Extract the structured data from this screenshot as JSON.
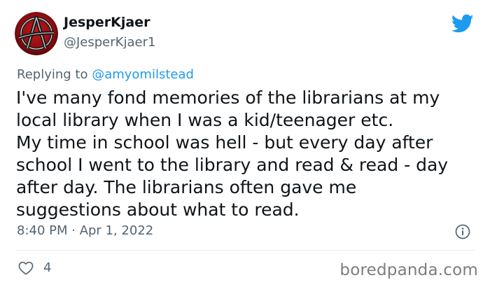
{
  "author": {
    "display_name": "JesperKjaer",
    "handle": "@JesperKjaer1",
    "avatar_icon": "anarchy-a-icon"
  },
  "platform_icon": "twitter-bird-icon",
  "reply": {
    "prefix": "Replying to ",
    "mention": "@amyomilstead"
  },
  "tweet": {
    "text": "I've many fond memories of the librarians at my\nlocal library when I was a kid/teenager etc.\nMy time in school was hell - but every day after\nschool I went to the library and read & read - day\nafter day. The librarians often gave me\nsuggestions about what to read."
  },
  "meta": {
    "timestamp": "8:40 PM · Apr 1, 2022"
  },
  "actions": {
    "like_count": "4"
  },
  "watermark": "boredpanda.com",
  "colors": {
    "text": "#0f1419",
    "secondary": "#536471",
    "accent": "#1d9bf0",
    "divider": "#e6ecf0"
  }
}
